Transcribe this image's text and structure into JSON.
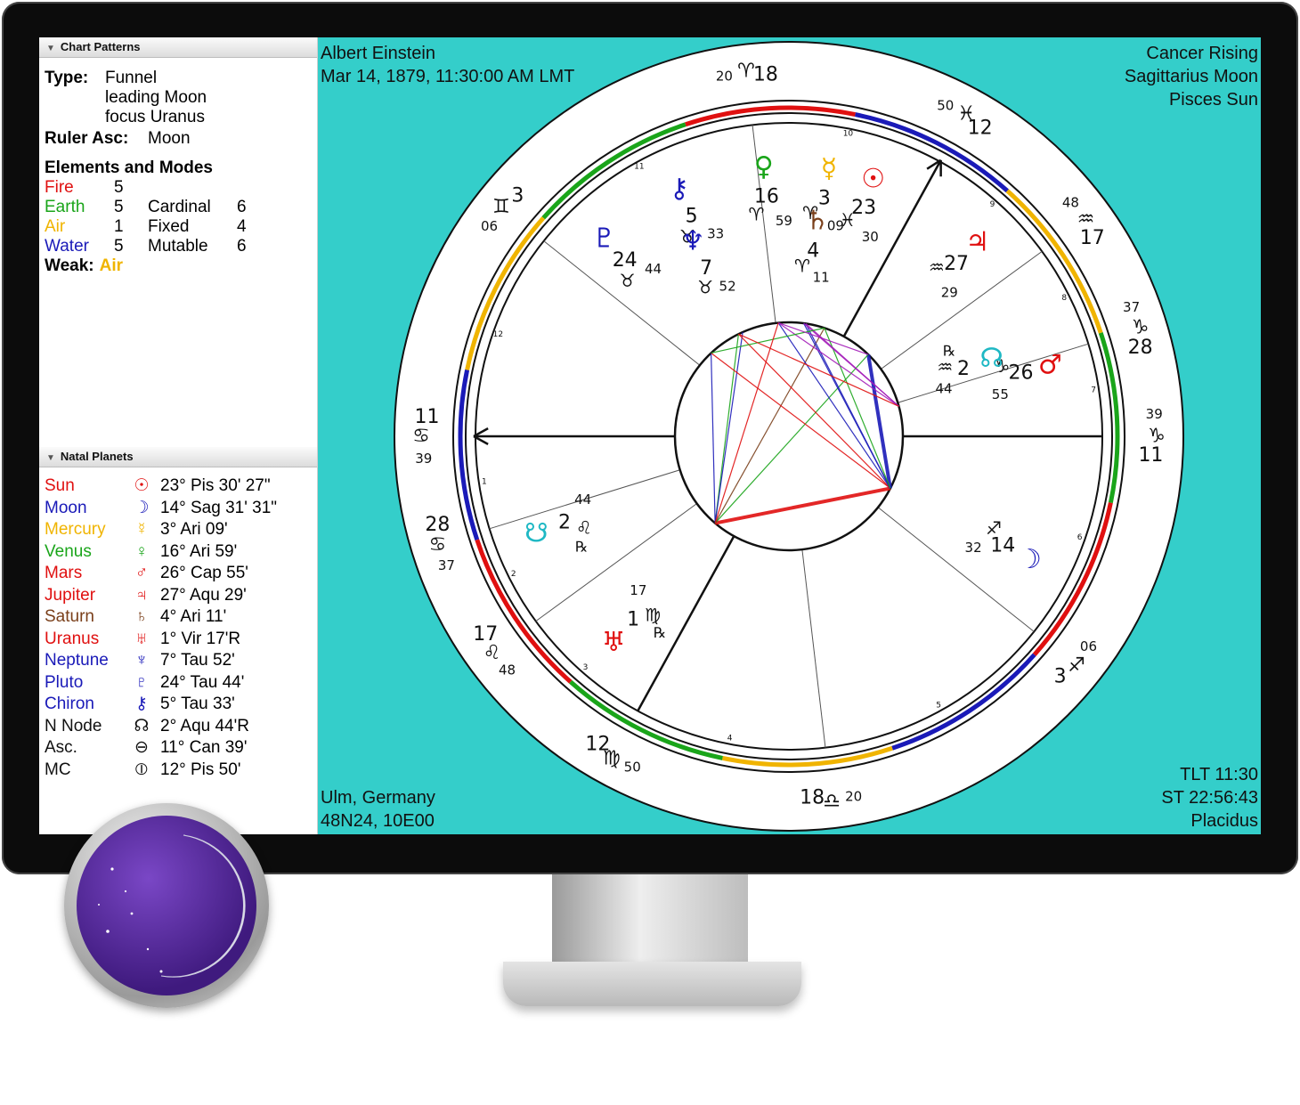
{
  "panel": {
    "chart_patterns": {
      "header": "Chart Patterns",
      "type_label": "Type:",
      "type_lines": [
        "Funnel",
        "leading Moon",
        "focus Uranus"
      ],
      "ruler_label": "Ruler Asc:",
      "ruler_value": "Moon"
    },
    "elements_modes": {
      "title": "Elements and Modes",
      "rows": [
        {
          "element": "Fire",
          "color": "#e01010",
          "count": "5",
          "mode": "",
          "mode_count": ""
        },
        {
          "element": "Earth",
          "color": "#1aa51a",
          "count": "5",
          "mode": "Cardinal",
          "mode_count": "6"
        },
        {
          "element": "Air",
          "color": "#f0b400",
          "count": "1",
          "mode": "Fixed",
          "mode_count": "4"
        },
        {
          "element": "Water",
          "color": "#1a1ab8",
          "count": "5",
          "mode": "Mutable",
          "mode_count": "6"
        }
      ],
      "weak_label": "Weak:",
      "weak_value": "Air",
      "weak_color": "#f0b400"
    },
    "natal_planets": {
      "header": "Natal Planets",
      "rows": [
        {
          "name": "Sun",
          "glyph": "☉",
          "color": "#e01010",
          "position": "23° Pis 30' 27\""
        },
        {
          "name": "Moon",
          "glyph": "☽",
          "color": "#1a1ab8",
          "position": "14° Sag 31' 31\""
        },
        {
          "name": "Mercury",
          "glyph": "☿",
          "color": "#f0b400",
          "position": "3° Ari 09'"
        },
        {
          "name": "Venus",
          "glyph": "♀",
          "color": "#1aa51a",
          "position": "16° Ari 59'"
        },
        {
          "name": "Mars",
          "glyph": "♂",
          "color": "#e01010",
          "position": "26° Cap 55'"
        },
        {
          "name": "Jupiter",
          "glyph": "♃",
          "color": "#e01010",
          "position": "27° Aqu 29'"
        },
        {
          "name": "Saturn",
          "glyph": "♄",
          "color": "#7a3f1a",
          "position": "4° Ari 11'"
        },
        {
          "name": "Uranus",
          "glyph": "♅",
          "color": "#e01010",
          "position": "1° Vir 17'R"
        },
        {
          "name": "Neptune",
          "glyph": "♆",
          "color": "#1a1ab8",
          "position": "7° Tau 52'"
        },
        {
          "name": "Pluto",
          "glyph": "♇",
          "color": "#1a1ab8",
          "position": "24° Tau 44'"
        },
        {
          "name": "Chiron",
          "glyph": "⚷",
          "color": "#1a1ab8",
          "position": "5° Tau 33'"
        },
        {
          "name": "N Node",
          "glyph": "☊",
          "color": "#111111",
          "position": "2° Aqu 44'R"
        },
        {
          "name": "Asc.",
          "glyph": "⊖",
          "color": "#111111",
          "position": "11° Can 39'"
        },
        {
          "name": "MC",
          "glyph": "⦶",
          "color": "#111111",
          "position": "12° Pis 50'"
        }
      ]
    }
  },
  "chart": {
    "top_left": [
      "Albert Einstein",
      "Mar 14, 1879, 11:30:00 AM LMT"
    ],
    "top_right": [
      "Cancer Rising",
      "Sagittarius Moon",
      "Pisces Sun"
    ],
    "bottom_left": [
      "Ulm, Germany",
      "48N24, 10E00"
    ],
    "bottom_right": [
      "TLT 11:30",
      "ST 22:56:43",
      "Placidus"
    ],
    "background": "#34ceca",
    "asc_longitude": 101.65,
    "cusps": [
      {
        "house": 1,
        "lon": 101.65,
        "deg": "11",
        "min": "39",
        "sign": "♋"
      },
      {
        "house": 2,
        "lon": 118.8,
        "deg": "28",
        "min": "37",
        "sign": "♋"
      },
      {
        "house": 3,
        "lon": 137.8,
        "deg": "17",
        "min": "48",
        "sign": "♌"
      },
      {
        "house": 4,
        "lon": 162.83,
        "deg": "12",
        "min": "50",
        "sign": "♍"
      },
      {
        "house": 5,
        "lon": 198.33,
        "deg": "18",
        "min": "20",
        "sign": "♎"
      },
      {
        "house": 6,
        "lon": 243.1,
        "deg": "3",
        "min": "06",
        "sign": "♐"
      },
      {
        "house": 7,
        "lon": 281.65,
        "deg": "11",
        "min": "39",
        "sign": "♑"
      },
      {
        "house": 8,
        "lon": 298.8,
        "deg": "28",
        "min": "37",
        "sign": "♑"
      },
      {
        "house": 9,
        "lon": 317.8,
        "deg": "17",
        "min": "48",
        "sign": "♒"
      },
      {
        "house": 10,
        "lon": 342.83,
        "deg": "12",
        "min": "50",
        "sign": "♓"
      },
      {
        "house": 11,
        "lon": 18.33,
        "deg": "18",
        "min": "20",
        "sign": "♈"
      },
      {
        "house": 12,
        "lon": 63.1,
        "deg": "3",
        "min": "06",
        "sign": "♊"
      }
    ],
    "planets": [
      {
        "name": "sun",
        "glyph": "☉",
        "color": "#e01010",
        "lon": 353.5,
        "deg": "23",
        "min": "30",
        "sign": "♓",
        "retro": ""
      },
      {
        "name": "moon",
        "glyph": "☽",
        "color": "#1a1ab8",
        "lon": 254.5,
        "deg": "14",
        "min": "32",
        "sign": "♐",
        "retro": ""
      },
      {
        "name": "mercury",
        "glyph": "☿",
        "color": "#f0b400",
        "lon": 3.15,
        "deg": "3",
        "min": "09",
        "sign": "♈",
        "retro": ""
      },
      {
        "name": "venus",
        "glyph": "♀",
        "color": "#1aa51a",
        "lon": 16.98,
        "deg": "16",
        "min": "59",
        "sign": "♈",
        "retro": ""
      },
      {
        "name": "mars",
        "glyph": "♂",
        "color": "#e01010",
        "lon": 296.9,
        "deg": "26",
        "min": "55",
        "sign": "♑",
        "retro": ""
      },
      {
        "name": "jupiter",
        "glyph": "♃",
        "color": "#e01010",
        "lon": 327.5,
        "deg": "27",
        "min": "29",
        "sign": "♒",
        "retro": ""
      },
      {
        "name": "saturn",
        "glyph": "♄",
        "color": "#7a3f1a",
        "lon": 4.18,
        "deg": "4",
        "min": "11",
        "sign": "♈",
        "retro": ""
      },
      {
        "name": "uranus",
        "glyph": "♅",
        "color": "#e01010",
        "lon": 151.3,
        "deg": "1",
        "min": "17",
        "sign": "♍",
        "retro": "℞"
      },
      {
        "name": "neptune",
        "glyph": "♆",
        "color": "#1a1ab8",
        "lon": 37.9,
        "deg": "7",
        "min": "52",
        "sign": "♉",
        "retro": ""
      },
      {
        "name": "pluto",
        "glyph": "♇",
        "color": "#1a1ab8",
        "lon": 54.7,
        "deg": "24",
        "min": "44",
        "sign": "♉",
        "retro": ""
      },
      {
        "name": "chiron",
        "glyph": "⚷",
        "color": "#1a1ab8",
        "lon": 35.55,
        "deg": "5",
        "min": "33",
        "sign": "♉",
        "retro": ""
      },
      {
        "name": "north-node",
        "glyph": "☊",
        "color": "#1fb8c4",
        "lon": 302.7,
        "deg": "2",
        "min": "44",
        "sign": "♒",
        "retro": "℞"
      },
      {
        "name": "south-node",
        "glyph": "☋",
        "color": "#1fb8c4",
        "lon": 122.7,
        "deg": "2",
        "min": "44",
        "sign": "♌",
        "retro": "℞"
      }
    ],
    "signs": [
      {
        "glyph": "♈",
        "element": "fire"
      },
      {
        "glyph": "♉",
        "element": "earth"
      },
      {
        "glyph": "♊",
        "element": "air"
      },
      {
        "glyph": "♋",
        "element": "water"
      },
      {
        "glyph": "♌",
        "element": "fire"
      },
      {
        "glyph": "♍",
        "element": "earth"
      },
      {
        "glyph": "♎",
        "element": "air"
      },
      {
        "glyph": "♏",
        "element": "water"
      },
      {
        "glyph": "♐",
        "element": "fire"
      },
      {
        "glyph": "♑",
        "element": "earth"
      },
      {
        "glyph": "♒",
        "element": "air"
      },
      {
        "glyph": "♓",
        "element": "water"
      }
    ],
    "element_colors": {
      "fire": "#e01010",
      "earth": "#1aa51a",
      "air": "#f0b400",
      "water": "#1a1ab8"
    },
    "aspects": [
      {
        "a": "moon",
        "b": "uranus",
        "color": "#e01010",
        "heavy": true
      },
      {
        "a": "moon",
        "b": "jupiter",
        "color": "#1a1ab8",
        "heavy": true
      },
      {
        "a": "uranus",
        "b": "jupiter",
        "color": "#1aa51a",
        "heavy": false
      },
      {
        "a": "uranus",
        "b": "neptune",
        "color": "#1aa51a",
        "heavy": false
      },
      {
        "a": "uranus",
        "b": "pluto",
        "color": "#1a1ab8",
        "heavy": false
      },
      {
        "a": "uranus",
        "b": "chiron",
        "color": "#1a1ab8",
        "heavy": false
      },
      {
        "a": "uranus",
        "b": "sun",
        "color": "#7a3f1a",
        "heavy": false
      },
      {
        "a": "moon",
        "b": "neptune",
        "color": "#e01010",
        "heavy": false
      },
      {
        "a": "moon",
        "b": "pluto",
        "color": "#e01010",
        "heavy": false
      },
      {
        "a": "moon",
        "b": "mercury",
        "color": "#1a1ab8",
        "heavy": false
      },
      {
        "a": "moon",
        "b": "saturn",
        "color": "#1a1ab8",
        "heavy": false
      },
      {
        "a": "moon",
        "b": "venus",
        "color": "#1a1ab8",
        "heavy": false
      },
      {
        "a": "moon",
        "b": "sun",
        "color": "#1aa51a",
        "heavy": false
      },
      {
        "a": "mercury",
        "b": "mars",
        "color": "#a31ab8",
        "heavy": false
      },
      {
        "a": "saturn",
        "b": "mars",
        "color": "#a31ab8",
        "heavy": false
      },
      {
        "a": "venus",
        "b": "mars",
        "color": "#a31ab8",
        "heavy": false
      },
      {
        "a": "sun",
        "b": "pluto",
        "color": "#1aa51a",
        "heavy": false
      },
      {
        "a": "jupiter",
        "b": "venus",
        "color": "#a31ab8",
        "heavy": false
      },
      {
        "a": "mars",
        "b": "neptune",
        "color": "#e01010",
        "heavy": false
      },
      {
        "a": "venus",
        "b": "uranus",
        "color": "#e01010",
        "heavy": false
      }
    ]
  }
}
